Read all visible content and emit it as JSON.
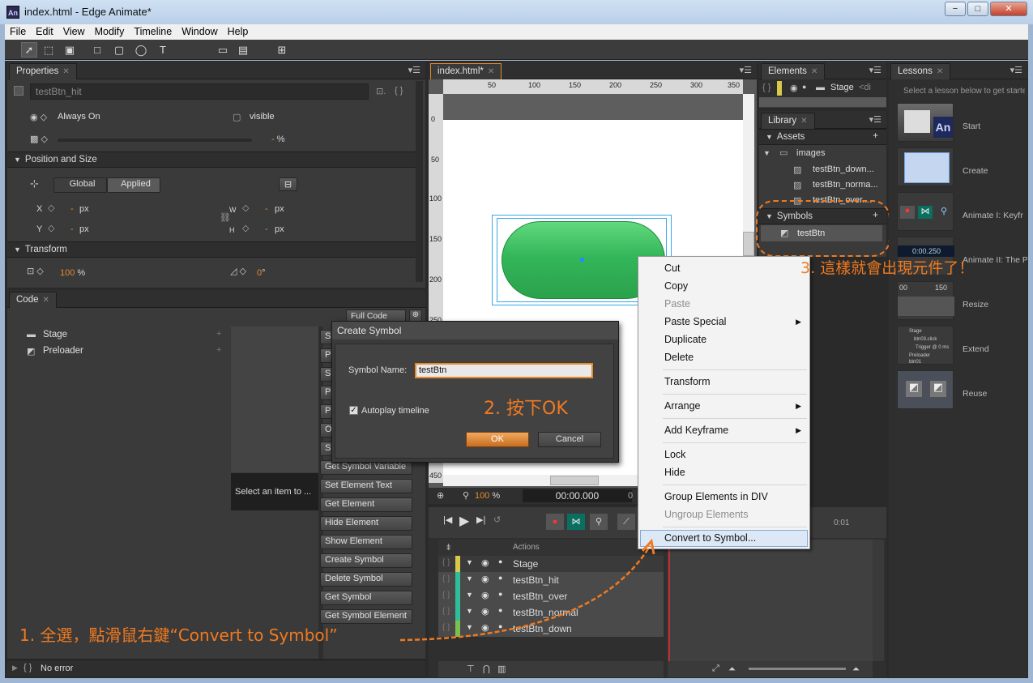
{
  "window": {
    "title": "index.html - Edge Animate*",
    "app_icon": "An",
    "btn_min": "−",
    "btn_max": "□",
    "btn_close": "✕"
  },
  "menu": [
    "File",
    "Edit",
    "View",
    "Modify",
    "Timeline",
    "Window",
    "Help"
  ],
  "properties": {
    "tab": "Properties",
    "element_name": "testBtn_hit",
    "always_on": "Always On",
    "visible": "visible",
    "opacity_value": "-",
    "opacity_unit": "%",
    "position_section": "Position and Size",
    "global": "Global",
    "applied": "Applied",
    "x_label": "X",
    "y_label": "Y",
    "w_label": "W",
    "h_label": "H",
    "dash": "-",
    "px": "px",
    "transform_section": "Transform",
    "scale_value": "100",
    "scale_unit": "%",
    "rotate_value": "0",
    "rotate_unit": "°"
  },
  "code": {
    "tab": "Code",
    "tree": [
      "Stage",
      "Preloader"
    ],
    "full_code": "Full Code",
    "placeholder": "Select an item to ...",
    "buttons": [
      "Get Symbol Variable",
      "Set Element Text",
      "Get Element",
      "Hide Element",
      "Show Element",
      "Create Symbol",
      "Delete Symbol",
      "Get Symbol",
      "Get Symbol Element"
    ],
    "partial_letters": [
      "S",
      "P",
      "S",
      "P",
      "P",
      "O",
      "S"
    ]
  },
  "stage": {
    "tab": "index.html*",
    "ruler_top": [
      "50",
      "100",
      "150",
      "200",
      "250",
      "300",
      "350"
    ],
    "ruler_left": [
      "0",
      "50",
      "100",
      "150",
      "200",
      "250"
    ],
    "ruler_left_bottom": "450",
    "zoom": "100",
    "zoom_unit": "%",
    "time": "00:00.000",
    "time_end": "0"
  },
  "dialog": {
    "title": "Create Symbol",
    "name_label": "Symbol Name:",
    "name_value": "testBtn",
    "autoplay": "Autoplay timeline",
    "ok": "OK",
    "cancel": "Cancel"
  },
  "context_menu": {
    "items": [
      "Cut",
      "Copy",
      "Paste",
      "Paste Special",
      "Duplicate",
      "Delete",
      "Transform",
      "Arrange",
      "Add Keyframe",
      "Lock",
      "Hide",
      "Group Elements in DIV",
      "Ungroup Elements",
      "Convert to Symbol..."
    ]
  },
  "elements": {
    "tab": "Elements",
    "stage": "Stage",
    "div": "<di"
  },
  "library": {
    "tab": "Library",
    "assets": "Assets",
    "images": "images",
    "files": [
      "testBtn_down...",
      "testBtn_norma...",
      "testBtn_over...."
    ],
    "symbols": "Symbols",
    "symbol_item": "testBtn"
  },
  "lessons": {
    "tab": "Lessons",
    "hint": "Select a lesson below to get starte",
    "items": [
      "Start",
      "Create",
      "Animate I: Keyfr",
      "Animate II: The P",
      "Resize",
      "Extend",
      "Reuse"
    ],
    "thumb_an": "An",
    "thumb_time": "0:00.250",
    "thumb_ruler_a": "00",
    "thumb_ruler_b": "150",
    "thumb_tree": [
      "Stage",
      "btn03.click",
      "Trigger @ 0 ms",
      "Preloader",
      "btn01"
    ]
  },
  "timeline": {
    "actions": "Actions",
    "time_label": "0:01",
    "layers": [
      {
        "name": "Stage",
        "color": "#d9c94a"
      },
      {
        "name": "testBtn_hit",
        "color": "#2ebf9a"
      },
      {
        "name": "testBtn_over",
        "color": "#2ebf9a"
      },
      {
        "name": "testBtn_normal",
        "color": "#2ebf9a"
      },
      {
        "name": "testBtn_down",
        "color": "#7ec04e"
      }
    ]
  },
  "status": {
    "text": "No error"
  },
  "annotations": {
    "step1_num": "1.",
    "step1": "全選，點滑鼠右鍵“Convert to Symbol”",
    "step2_num": "2.",
    "step2": "按下OK",
    "step3_num": "3.",
    "step3": "這樣就會出現元件了！"
  },
  "colors": {
    "accent": "#e58a2a",
    "annotation": "#f07a20",
    "panel": "#3a3a3a",
    "highlight": "#dde8f6"
  }
}
